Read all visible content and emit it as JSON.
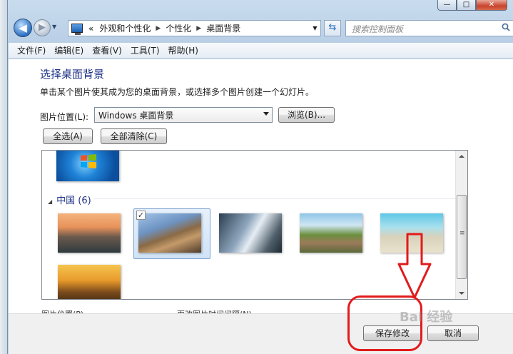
{
  "window": {
    "min_glyph": "—",
    "max_glyph": "□",
    "close_glyph": "✕"
  },
  "nav": {
    "back_glyph": "◀",
    "forward_glyph": "▶",
    "address_prefix": "«",
    "breadcrumbs": [
      "外观和个性化",
      "个性化",
      "桌面背景"
    ],
    "search_placeholder": "搜索控制面板"
  },
  "menubar": [
    "文件(F)",
    "编辑(E)",
    "查看(V)",
    "工具(T)",
    "帮助(H)"
  ],
  "page": {
    "title": "选择桌面背景",
    "description": "单击某个图片使其成为您的桌面背景，或选择多个图片创建一个幻灯片。",
    "location_label": "图片位置(L):",
    "location_value": "Windows 桌面背景",
    "browse_label": "浏览(B)...",
    "select_all_label": "全选(A)",
    "clear_all_label": "全部清除(C)"
  },
  "gallery": {
    "group_name": "中国 (6)",
    "selected_index": 1
  },
  "bottom_labels": {
    "picture_position": "图片位置(P)",
    "change_interval": "更改图片时间间隔(N)"
  },
  "footer": {
    "save_label": "保存修改",
    "cancel_label": "取消"
  },
  "watermark": "Bai 经验",
  "colors": {
    "title": "#1e3287",
    "annotation_red": "#e21b1b"
  }
}
